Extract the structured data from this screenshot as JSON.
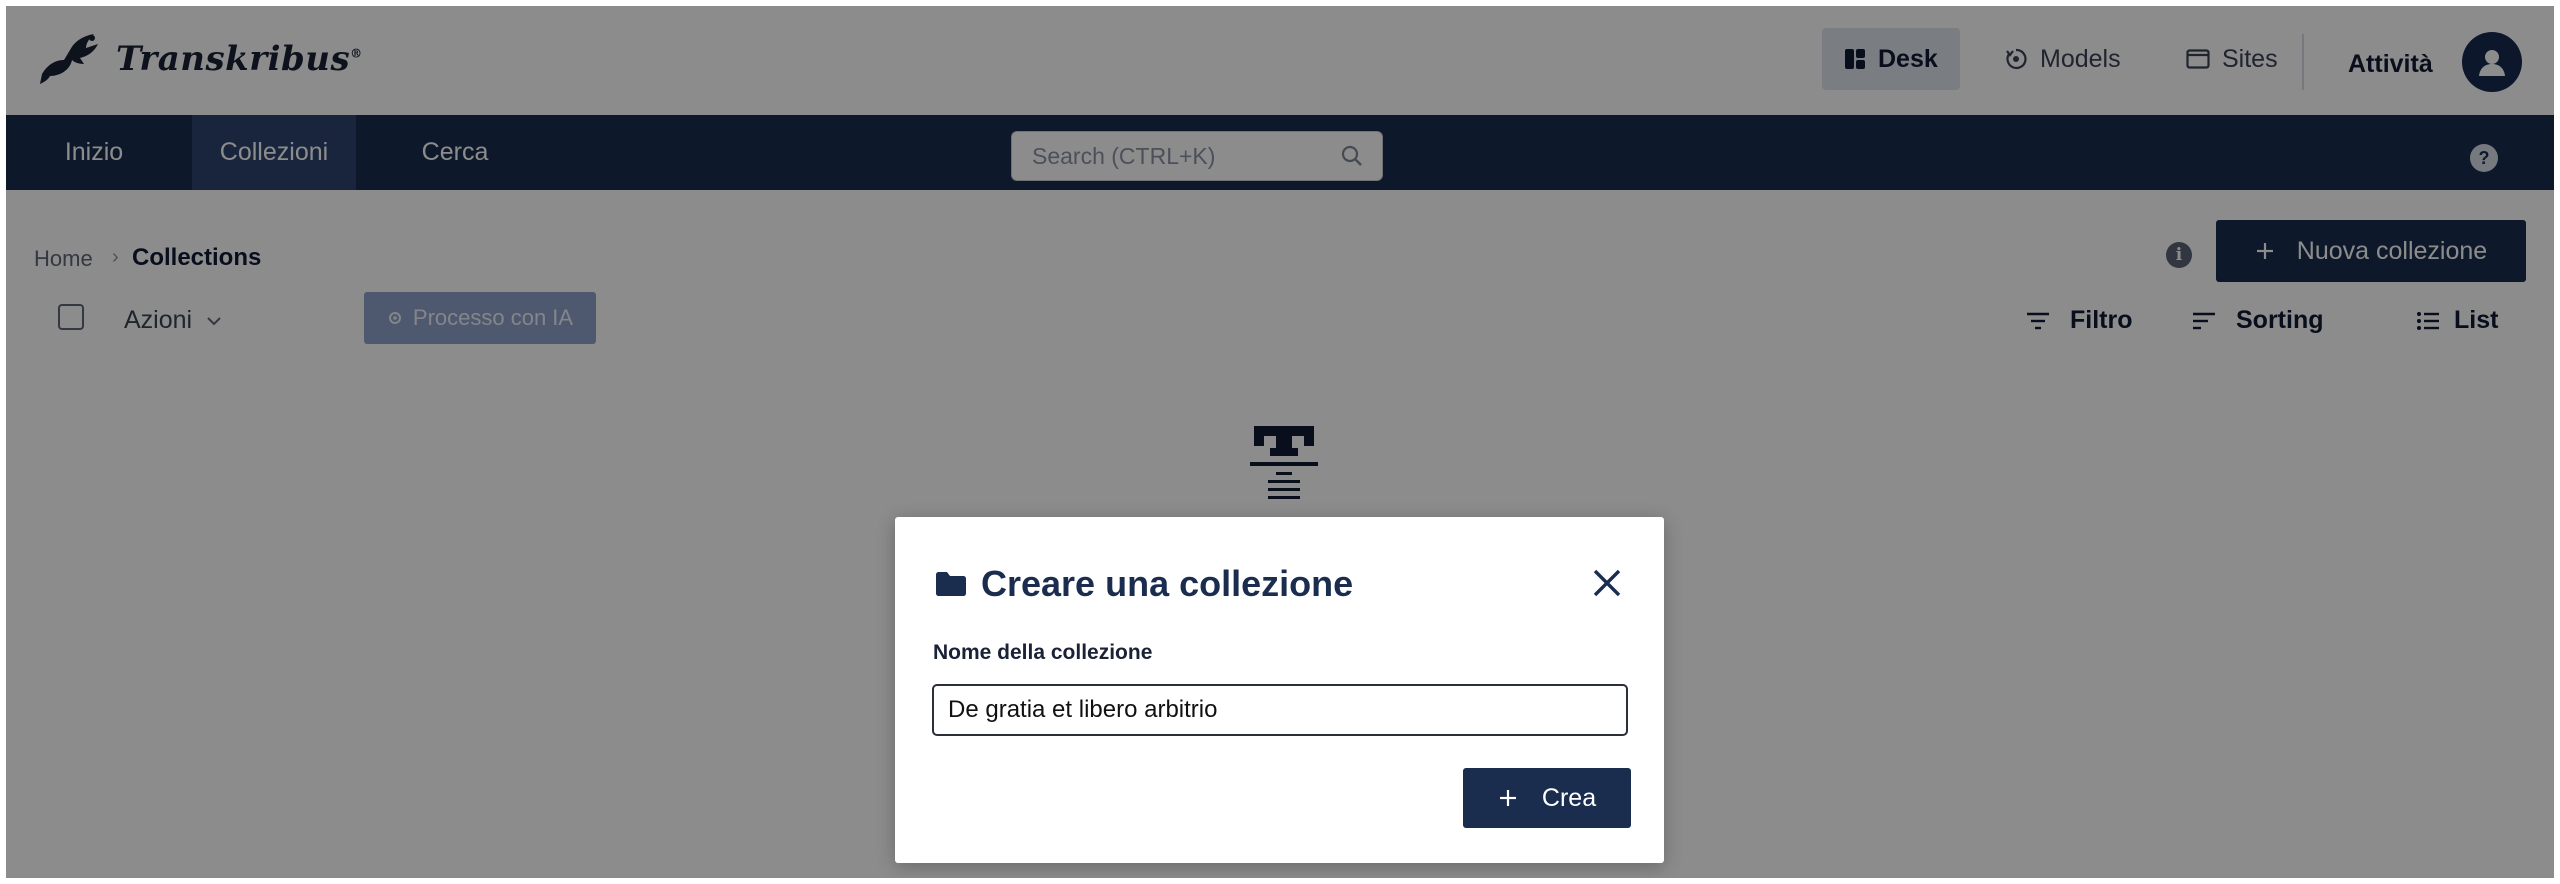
{
  "header": {
    "logo_text": "Transkribus",
    "logo_mark": "®",
    "nav": [
      {
        "label": "Desk",
        "icon": "desk-icon",
        "active": true
      },
      {
        "label": "Models",
        "icon": "models-icon",
        "active": false
      },
      {
        "label": "Sites",
        "icon": "sites-icon",
        "active": false
      }
    ],
    "activity_label": "Attività",
    "avatar_icon": "user-icon"
  },
  "navbar": {
    "items": [
      {
        "label": "Inizio",
        "active": false
      },
      {
        "label": "Collezioni",
        "active": true
      },
      {
        "label": "Cerca",
        "active": false
      }
    ],
    "search_placeholder": "Search (CTRL+K)",
    "help_label": "?"
  },
  "breadcrumb": {
    "home": "Home",
    "separator": "›",
    "current": "Collections"
  },
  "toolbar": {
    "info_label": "i",
    "new_collection_label": "Nuova collezione",
    "actions_label": "Azioni",
    "ai_process_label": "Processo con IA",
    "filter_label": "Filtro",
    "sorting_label": "Sorting",
    "list_label": "List"
  },
  "modal": {
    "title": "Creare una collezione",
    "field_label": "Nome della collezione",
    "field_value": "De gratia et libero arbitrio",
    "create_label": "Crea"
  },
  "colors": {
    "navy": "#1b2d4f",
    "nav_active": "#2c4470",
    "overlay": "rgba(0,0,0,0.45)",
    "ai_button": "#8ea2cc"
  }
}
